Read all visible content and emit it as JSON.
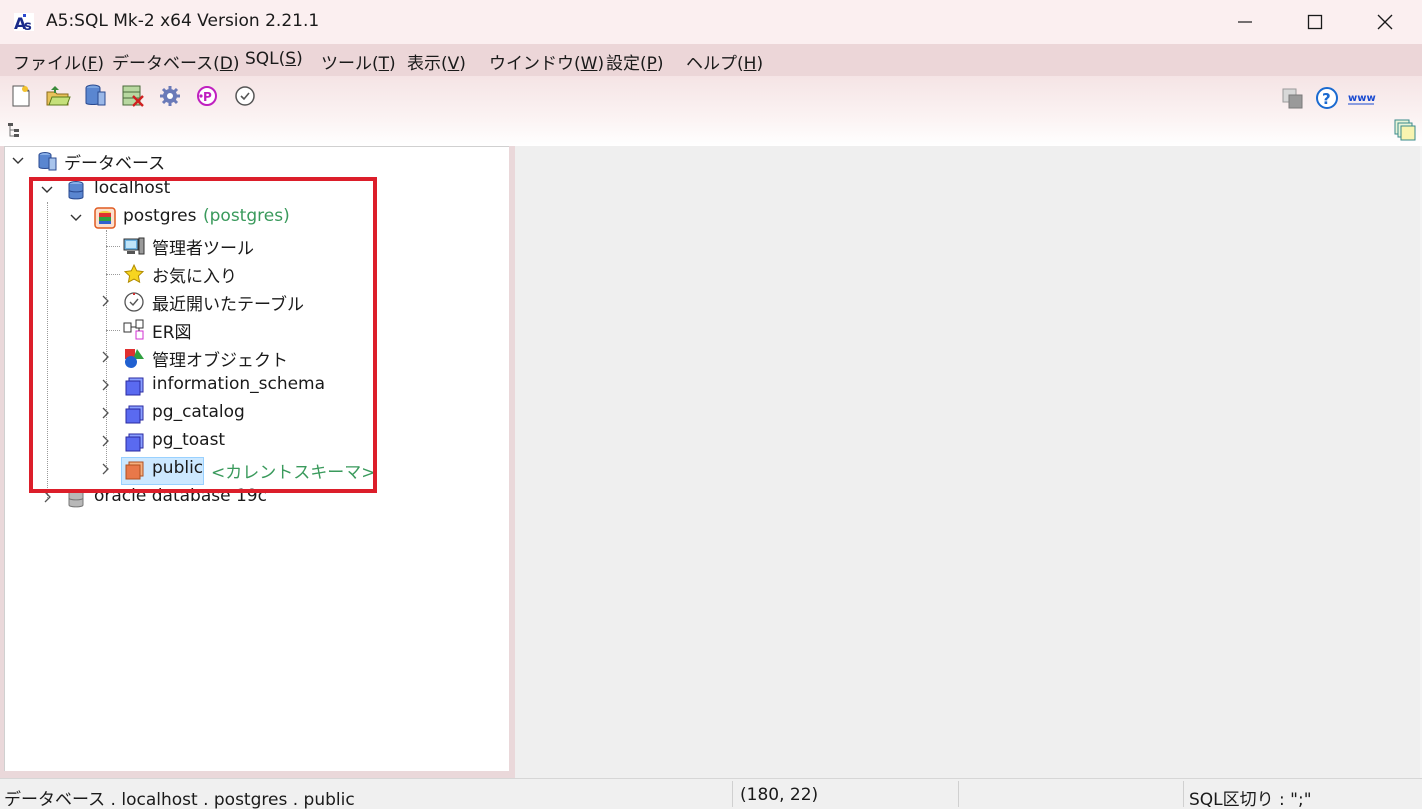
{
  "window": {
    "title": "A5:SQL Mk-2 x64 Version 2.21.1"
  },
  "menu": [
    {
      "label": "ファイル(",
      "key": "F",
      "close": ")"
    },
    {
      "label": "データベース(",
      "key": "D",
      "close": ")"
    },
    {
      "label": "SQL(",
      "key": "S",
      "close": ")"
    },
    {
      "label": "ツール(",
      "key": "T",
      "close": ")"
    },
    {
      "label": "表示(",
      "key": "V",
      "close": ")"
    },
    {
      "label": "ウインドウ(",
      "key": "W",
      "close": ")"
    },
    {
      "label": "設定(",
      "key": "P",
      "close": ")"
    },
    {
      "label": "ヘルプ(",
      "key": "H",
      "close": ")"
    }
  ],
  "toolbar": {
    "left_icons": [
      "new-document-icon",
      "open-folder-icon",
      "database-connect-icon",
      "database-disconnect-icon",
      "gear-icon",
      "plugin-icon",
      "history-clock-icon"
    ],
    "right_icons": [
      "window-tile-icon",
      "help-icon",
      "www-icon"
    ],
    "www_label": "www",
    "help_glyph": "?"
  },
  "tree": {
    "root": "データベース",
    "localhost": "localhost",
    "postgres": "postgres",
    "postgres_owner": "(postgres)",
    "admin_tool": "管理者ツール",
    "favorites": "お気に入り",
    "recent_tables": "最近開いたテーブル",
    "er_diagram": "ER図",
    "admin_objects": "管理オブジェクト",
    "information_schema": "information_schema",
    "pg_catalog": "pg_catalog",
    "pg_toast": "pg_toast",
    "public": "public",
    "current_schema": "<カレントスキーマ>",
    "oracle": "oracle database 19c"
  },
  "status": {
    "path": "データベース . localhost . postgres . public",
    "position": "(180, 22)",
    "sql_delimiter": "SQL区切り : \";\""
  },
  "colors": {
    "highlight_border": "#dc1e2a",
    "current_schema_text": "#3a9a5c",
    "titlebar_bg": "#fbeff0",
    "menubar_bg": "#ecd6d8"
  }
}
